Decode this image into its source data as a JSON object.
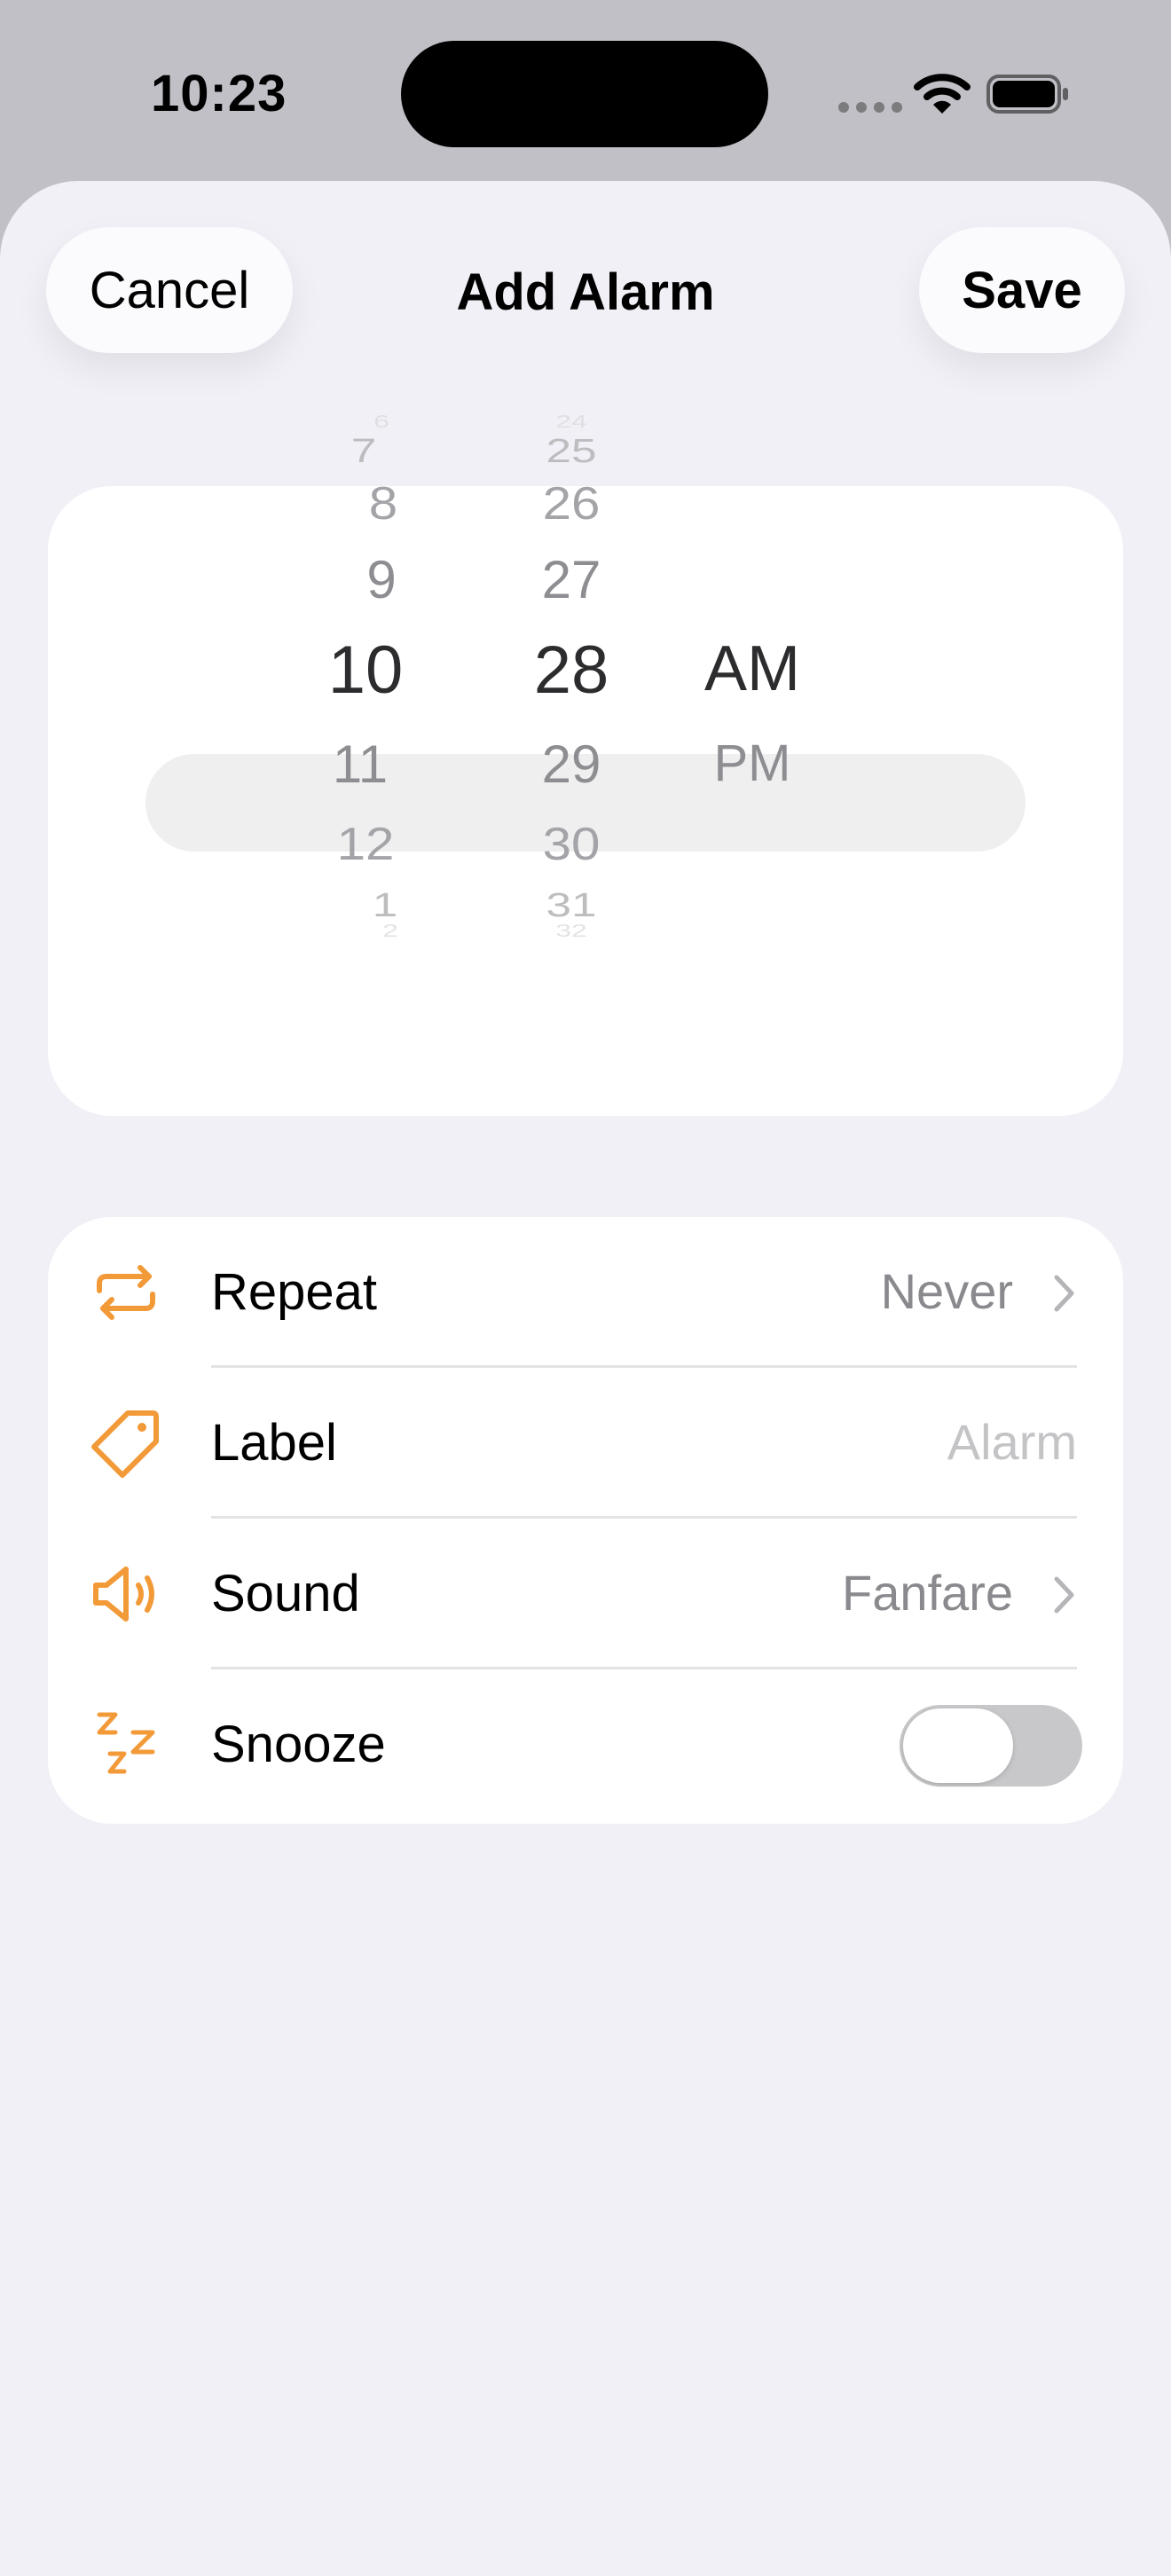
{
  "status_bar": {
    "time": "10:23"
  },
  "header": {
    "cancel_label": "Cancel",
    "title": "Add Alarm",
    "save_label": "Save"
  },
  "picker": {
    "hours": [
      "6",
      "7",
      "8",
      "9",
      "10",
      "11",
      "12",
      "1",
      "2"
    ],
    "minutes": [
      "24",
      "25",
      "26",
      "27",
      "28",
      "29",
      "30",
      "31",
      "32"
    ],
    "periods": [
      "AM",
      "PM"
    ],
    "selected": {
      "hour": "10",
      "minute": "28",
      "period": "AM"
    }
  },
  "settings": {
    "repeat": {
      "label": "Repeat",
      "value": "Never",
      "icon": "repeat-icon"
    },
    "alarm_label": {
      "label": "Label",
      "placeholder": "Alarm",
      "icon": "tag-icon"
    },
    "sound": {
      "label": "Sound",
      "value": "Fanfare",
      "icon": "speaker-icon"
    },
    "snooze": {
      "label": "Snooze",
      "enabled": false,
      "icon": "snooze-icon"
    }
  },
  "colors": {
    "accent": "#f39a38",
    "sheet_bg": "#f1f0f6",
    "toggle_off": "#c8c8cb"
  }
}
